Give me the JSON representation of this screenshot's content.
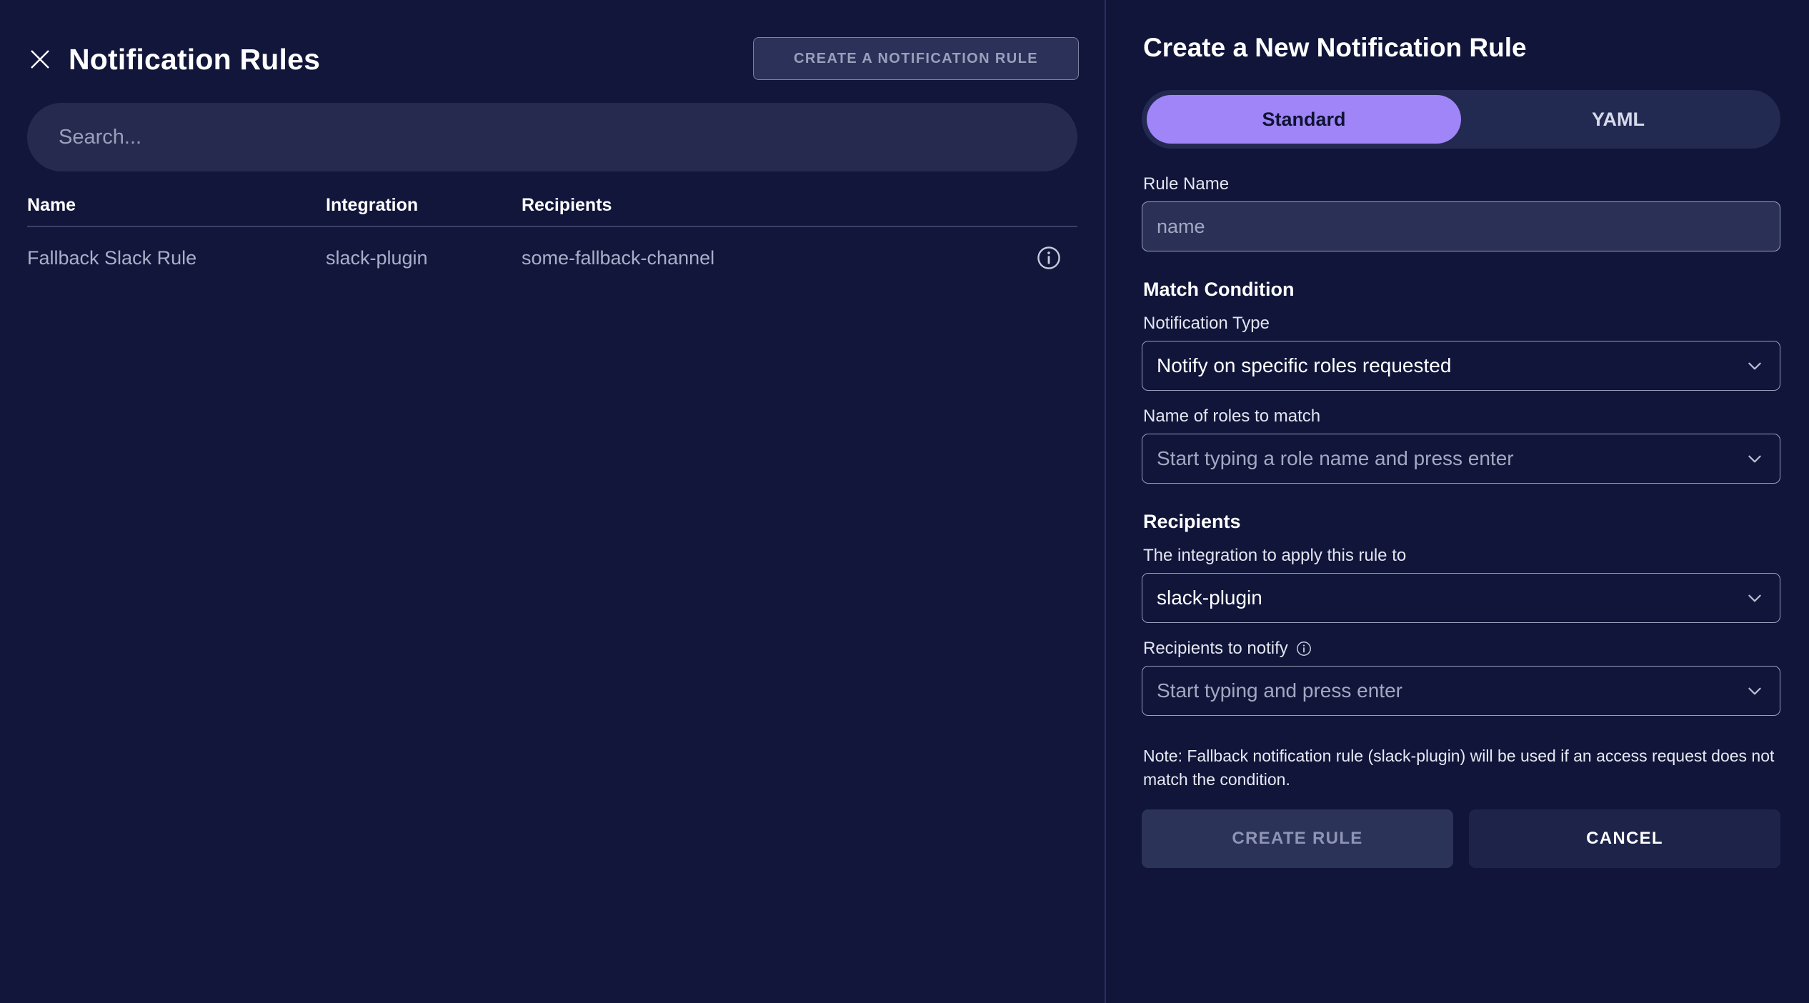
{
  "colors": {
    "left_bg": "#11163a",
    "right_bg": "#101539",
    "accent_purple": "#9f85f7",
    "search_bg": "#252a4e",
    "input_bg": "#2b3056",
    "field_border": "#9aa0bb",
    "disabled_text": "#8e94b4",
    "row_text": "#a9afc9"
  },
  "left": {
    "close_icon": "close-icon",
    "title": "Notification Rules",
    "create_button_label": "CREATE A NOTIFICATION RULE",
    "search": {
      "value": "",
      "placeholder": "Search..."
    },
    "table": {
      "columns": [
        "Name",
        "Integration",
        "Recipients"
      ],
      "rows": [
        {
          "name": "Fallback Slack Rule",
          "integration": "slack-plugin",
          "recipients": "some-fallback-channel",
          "action_icon": "info-icon"
        }
      ]
    }
  },
  "right": {
    "title": "Create a New Notification Rule",
    "tabs": [
      {
        "label": "Standard",
        "active": true
      },
      {
        "label": "YAML",
        "active": false
      }
    ],
    "rule_name": {
      "label": "Rule Name",
      "value": "",
      "placeholder": "name"
    },
    "match_condition": {
      "section_title": "Match Condition",
      "notification_type": {
        "label": "Notification Type",
        "value": "Notify on specific roles requested",
        "chevron_icon": "chevron-down-icon"
      },
      "roles": {
        "label": "Name of roles to match",
        "placeholder": "Start typing a role name and press enter",
        "chevron_icon": "chevron-down-icon"
      }
    },
    "recipients": {
      "section_title": "Recipients",
      "integration": {
        "label": "The integration to apply this rule to",
        "value": "slack-plugin",
        "chevron_icon": "chevron-down-icon"
      },
      "notify": {
        "label": "Recipients to notify",
        "info_icon": "info-icon",
        "placeholder": "Start typing and press enter",
        "chevron_icon": "chevron-down-icon"
      }
    },
    "note": "Note: Fallback notification rule (slack-plugin) will be used if an access request does not match the condition.",
    "actions": {
      "create_label": "CREATE RULE",
      "cancel_label": "CANCEL"
    }
  }
}
